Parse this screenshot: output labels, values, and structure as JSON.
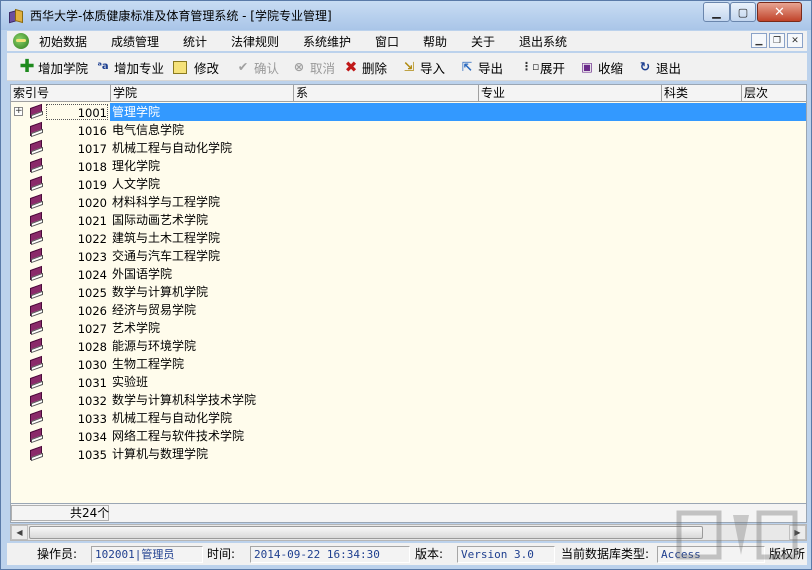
{
  "window": {
    "title": "西华大学-体质健康标准及体育管理系统 - [学院专业管理]",
    "min_label": "▁",
    "max_label": "▢",
    "close_label": "✕"
  },
  "menu": {
    "items": [
      "初始数据",
      "成绩管理",
      "统计",
      "法律规则",
      "系统维护",
      "窗口",
      "帮助",
      "关于",
      "退出系统"
    ],
    "mdi_min": "▁",
    "mdi_restore": "❐",
    "mdi_close": "✕"
  },
  "toolbar": {
    "add_college": "增加学院",
    "add_major": "增加专业",
    "edit": "修改",
    "confirm": "确认",
    "cancel": "取消",
    "delete": "删除",
    "import": "导入",
    "export": "导出",
    "expand": "展开",
    "collapse": "收缩",
    "exit": "退出"
  },
  "grid": {
    "columns": [
      "索引号",
      "学院",
      "系",
      "专业",
      "科类",
      "层次"
    ],
    "rows": [
      {
        "idx": "1001",
        "college": "管理学院"
      },
      {
        "idx": "1016",
        "college": "电气信息学院"
      },
      {
        "idx": "1017",
        "college": "机械工程与自动化学院"
      },
      {
        "idx": "1018",
        "college": "理化学院"
      },
      {
        "idx": "1019",
        "college": "人文学院"
      },
      {
        "idx": "1020",
        "college": "材料科学与工程学院"
      },
      {
        "idx": "1021",
        "college": "国际动画艺术学院"
      },
      {
        "idx": "1022",
        "college": "建筑与土木工程学院"
      },
      {
        "idx": "1023",
        "college": "交通与汽车工程学院"
      },
      {
        "idx": "1024",
        "college": "外国语学院"
      },
      {
        "idx": "1025",
        "college": "数学与计算机学院"
      },
      {
        "idx": "1026",
        "college": "经济与贸易学院"
      },
      {
        "idx": "1027",
        "college": "艺术学院"
      },
      {
        "idx": "1028",
        "college": "能源与环境学院"
      },
      {
        "idx": "1030",
        "college": "生物工程学院"
      },
      {
        "idx": "1031",
        "college": "实验班"
      },
      {
        "idx": "1032",
        "college": "数学与计算机科学技术学院"
      },
      {
        "idx": "1033",
        "college": "机械工程与自动化学院"
      },
      {
        "idx": "1034",
        "college": "网络工程与软件技术学院"
      },
      {
        "idx": "1035",
        "college": "计算机与数理学院"
      }
    ],
    "selected_index": 0,
    "count_label": "共24个"
  },
  "status": {
    "operator_label": "操作员:",
    "operator_value": "102001|管理员",
    "time_label": "时间:",
    "time_value": "2014-09-22 16:34:30",
    "version_label": "版本:",
    "version_value": "Version 3.0",
    "db_label": "当前数据库类型:",
    "db_value": "Access",
    "copyright_label": "版权所"
  },
  "colors": {
    "selection": "#3399ff",
    "grid_bg": "#fffcec",
    "status_value": "#1f3f8f"
  }
}
